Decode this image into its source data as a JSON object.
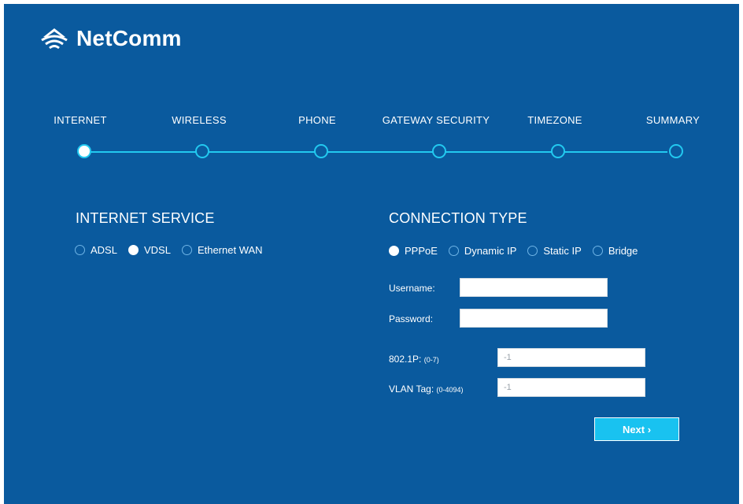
{
  "brand": {
    "name": "NetComm",
    "icon": "wifi-icon"
  },
  "steps": [
    {
      "label": "INTERNET",
      "active": true
    },
    {
      "label": "WIRELESS",
      "active": false
    },
    {
      "label": "PHONE",
      "active": false
    },
    {
      "label": "GATEWAY SECURITY",
      "active": false
    },
    {
      "label": "TIMEZONE",
      "active": false
    },
    {
      "label": "SUMMARY",
      "active": false
    }
  ],
  "internet_service": {
    "title": "INTERNET SERVICE",
    "options": [
      "ADSL",
      "VDSL",
      "Ethernet WAN"
    ],
    "selected": "VDSL"
  },
  "connection_type": {
    "title": "CONNECTION TYPE",
    "options": [
      "PPPoE",
      "Dynamic IP",
      "Static IP",
      "Bridge"
    ],
    "selected": "PPPoE"
  },
  "fields": {
    "username_label": "Username:",
    "username_value": "",
    "password_label": "Password:",
    "password_value": "",
    "priority_label": "802.1P:",
    "priority_hint": "(0-7)",
    "priority_value": "-1",
    "vlan_label": "VLAN Tag:",
    "vlan_hint": "(0-4094)",
    "vlan_value": "-1"
  },
  "next_label": "Next ›",
  "colors": {
    "background": "#0a5a9e",
    "accent": "#22c9f0",
    "button": "#19c2f0"
  }
}
